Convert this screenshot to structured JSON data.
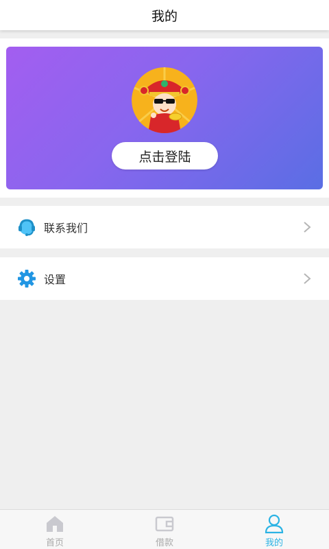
{
  "header": {
    "title": "我的"
  },
  "profile": {
    "avatar_icon": "god-of-wealth-cartoon-avatar",
    "login_label": "点击登陆",
    "gradient_colors": [
      "#a35ef0",
      "#5a6ee4"
    ]
  },
  "menu": [
    {
      "icon": "customer-service-headset-icon",
      "label": "联系我们"
    },
    {
      "icon": "gear-icon",
      "label": "设置"
    }
  ],
  "tabbar": {
    "tabs": [
      {
        "icon": "home-icon",
        "label": "首页",
        "active": false
      },
      {
        "icon": "wallet-icon",
        "label": "借款",
        "active": false
      },
      {
        "icon": "user-icon",
        "label": "我的",
        "active": true
      }
    ],
    "active_color": "#2bb3e4",
    "inactive_color": "#aaaaaa"
  }
}
